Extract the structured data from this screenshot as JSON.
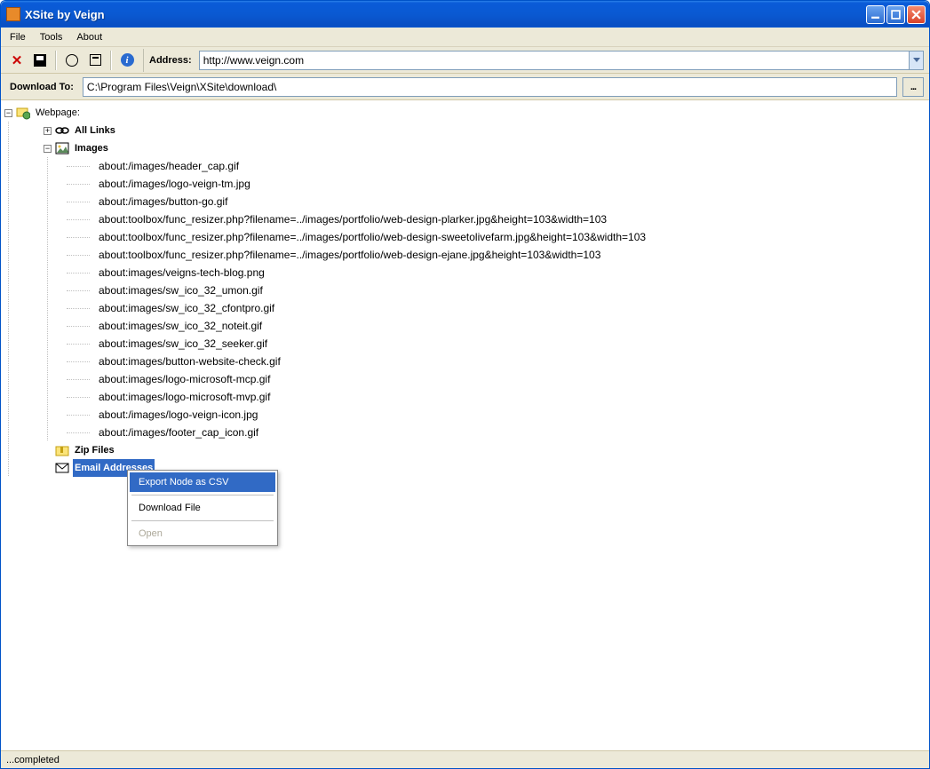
{
  "window": {
    "title": "XSite by Veign"
  },
  "menu": {
    "file": "File",
    "tools": "Tools",
    "about": "About"
  },
  "toolbar": {
    "address_label": "Address:",
    "address_value": "http://www.veign.com"
  },
  "download": {
    "label": "Download To:",
    "value": "C:\\Program Files\\Veign\\XSite\\download\\",
    "browse": "..."
  },
  "tree": {
    "root": "Webpage:",
    "all_links": "All Links",
    "images": "Images",
    "zip_files": "Zip Files",
    "email_addresses": "Email Addresses",
    "image_items": [
      "about:/images/header_cap.gif",
      "about:/images/logo-veign-tm.jpg",
      "about:/images/button-go.gif",
      "about:toolbox/func_resizer.php?filename=../images/portfolio/web-design-plarker.jpg&height=103&width=103",
      "about:toolbox/func_resizer.php?filename=../images/portfolio/web-design-sweetolivefarm.jpg&height=103&width=103",
      "about:toolbox/func_resizer.php?filename=../images/portfolio/web-design-ejane.jpg&height=103&width=103",
      "about:images/veigns-tech-blog.png",
      "about:images/sw_ico_32_umon.gif",
      "about:images/sw_ico_32_cfontpro.gif",
      "about:images/sw_ico_32_noteit.gif",
      "about:images/sw_ico_32_seeker.gif",
      "about:images/button-website-check.gif",
      "about:images/logo-microsoft-mcp.gif",
      "about:images/logo-microsoft-mvp.gif",
      "about:/images/logo-veign-icon.jpg",
      "about:/images/footer_cap_icon.gif"
    ]
  },
  "context_menu": {
    "export_csv": "Export Node as CSV",
    "download_file": "Download File",
    "open": "Open"
  },
  "status": {
    "text": "...completed"
  }
}
